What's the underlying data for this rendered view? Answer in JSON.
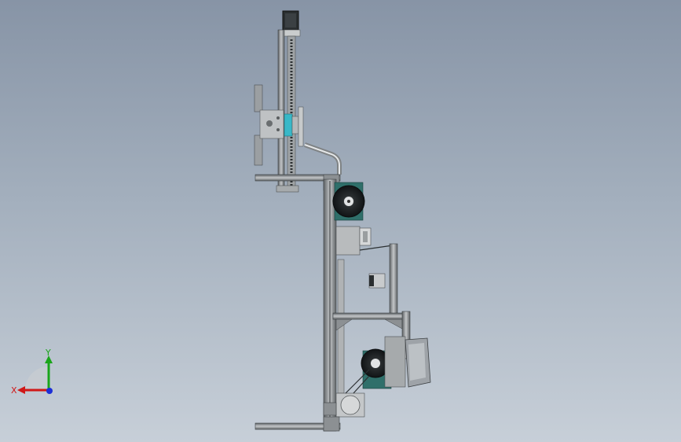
{
  "viewport": {
    "background_top": "#8794a6",
    "background_bottom": "#c7cfd8"
  },
  "model": {
    "frame_color": "#6f7376",
    "metal_color": "#b9bcbe",
    "dark_color": "#2f3437",
    "accent_teal": "#2f6f6a",
    "accent_cyan": "#38b8c8"
  },
  "triad": {
    "x_label": "X",
    "y_label": "Y",
    "x_color": "#d01818",
    "y_color": "#1aa51a",
    "z_color": "#1c2fd6"
  }
}
